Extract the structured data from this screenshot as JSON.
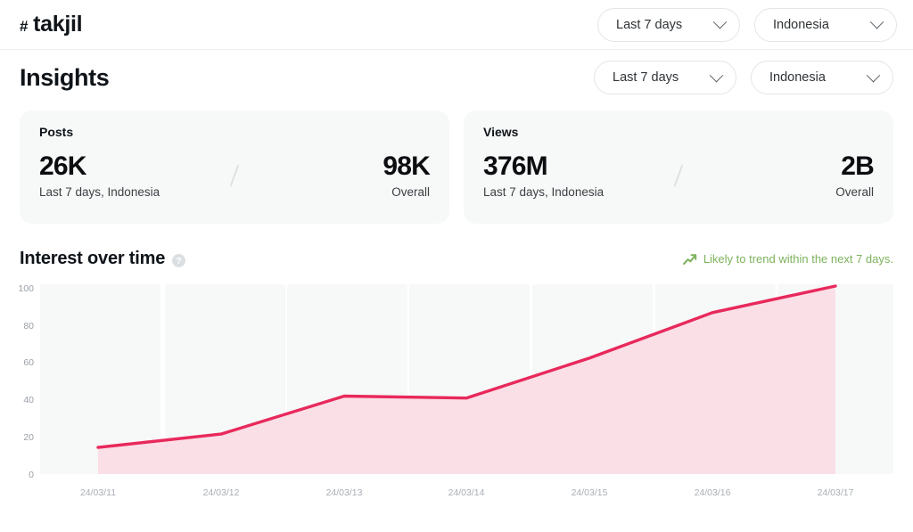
{
  "topbar": {
    "hash_symbol": "#",
    "hashtag": "takjil",
    "period_filter": {
      "label": "Last 7 days",
      "icon": "chevron-down-icon"
    },
    "region_filter": {
      "label": "Indonesia",
      "icon": "chevron-down-icon"
    }
  },
  "insights": {
    "title": "Insights",
    "period_filter": {
      "label": "Last 7 days",
      "icon": "chevron-down-icon"
    },
    "region_filter": {
      "label": "Indonesia",
      "icon": "chevron-down-icon"
    }
  },
  "cards": [
    {
      "title": "Posts",
      "primary_value": "26K",
      "primary_label": "Last 7 days, Indonesia",
      "secondary_value": "98K",
      "secondary_label": "Overall"
    },
    {
      "title": "Views",
      "primary_value": "376M",
      "primary_label": "Last 7 days, Indonesia",
      "secondary_value": "2B",
      "secondary_label": "Overall"
    }
  ],
  "interest_section": {
    "title": "Interest over time",
    "info_icon": "help-circle-icon",
    "info_icon_glyph": "?",
    "trend_icon": "trending-up-icon",
    "trend_note": "Likely to trend within the next 7 days.",
    "trend_color": "#7cb25c"
  },
  "chart_data": {
    "type": "area",
    "title": "Interest over time",
    "categories": [
      "24/03/11",
      "24/03/12",
      "24/03/13",
      "24/03/14",
      "24/03/15",
      "24/03/16",
      "24/03/17"
    ],
    "values": [
      15,
      22,
      42,
      41,
      62,
      86,
      100
    ],
    "xlabel": "",
    "ylabel": "",
    "ylim": [
      0,
      100
    ],
    "yticks": [
      0,
      20,
      40,
      60,
      80,
      100
    ],
    "ytick_labels": [
      "0",
      "20",
      "40",
      "60",
      "80",
      "100"
    ],
    "grid": false,
    "legend": "none",
    "line_color": "#e8295c",
    "fill_color": "#fbdfe6",
    "band_color": "#f7f8f8"
  }
}
